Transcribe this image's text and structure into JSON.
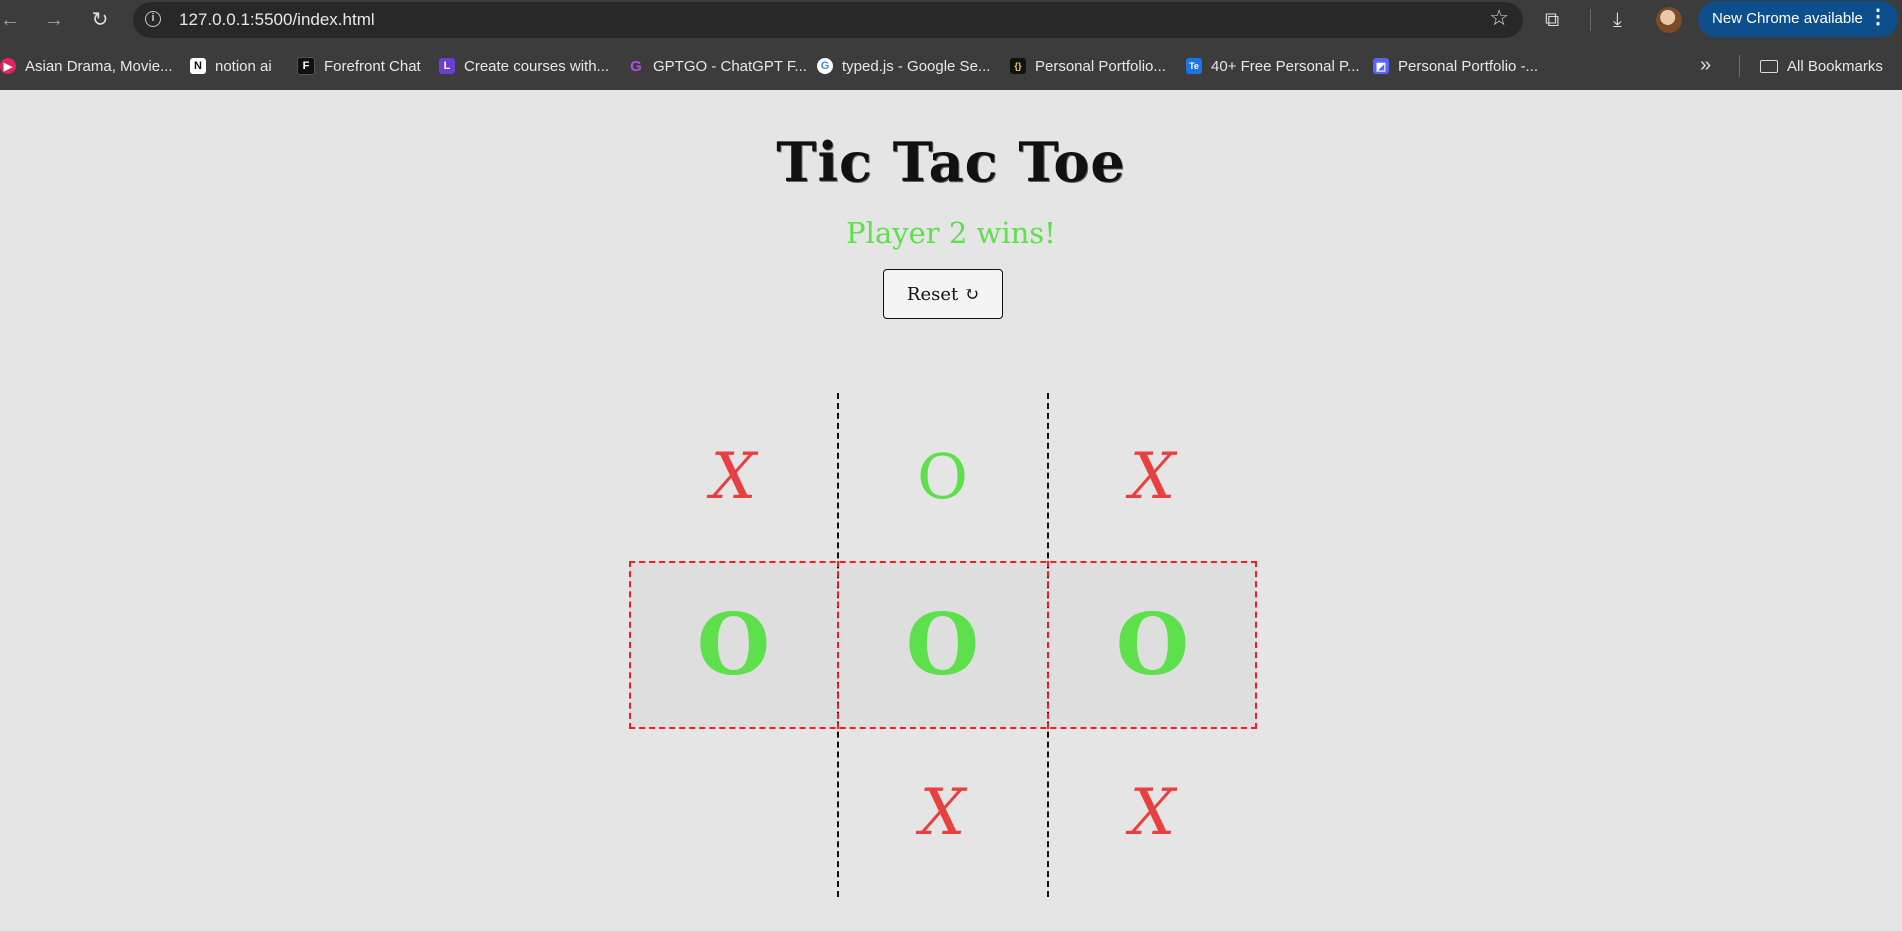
{
  "browser": {
    "url": "127.0.0.1:5500/index.html",
    "update_label": "New Chrome available",
    "bookmarks": [
      {
        "label": "Asian Drama, Movie...",
        "icon": "play-icon",
        "color": "#e0245e"
      },
      {
        "label": "notion ai",
        "icon": "notion-icon",
        "color": "#ffffff"
      },
      {
        "label": "Forefront Chat",
        "icon": "forefront-icon",
        "color": "#111111"
      },
      {
        "label": "Create courses with...",
        "icon": "letter-l-icon",
        "color": "#6b3fd6"
      },
      {
        "label": "GPTGO - ChatGPT F...",
        "icon": "letter-g-icon",
        "color": "#b14fe6"
      },
      {
        "label": "typed.js - Google Se...",
        "icon": "google-icon",
        "color": "#ffffff"
      },
      {
        "label": "Personal Portfolio...",
        "icon": "code-icon",
        "color": "#111111"
      },
      {
        "label": "40+ Free Personal P...",
        "icon": "te-icon",
        "color": "#1e73e8"
      },
      {
        "label": "Personal Portfolio -...",
        "icon": "portfolio-icon",
        "color": "#5865f2"
      }
    ],
    "all_bookmarks_label": "All Bookmarks"
  },
  "game": {
    "title": "Tic Tac Toe",
    "status": "Player 2 wins!",
    "reset_label": "Reset ↻",
    "board": [
      "X",
      "O",
      "X",
      "O",
      "O",
      "O",
      "",
      "X",
      "X"
    ],
    "winning_row": [
      3,
      4,
      5
    ],
    "x_color": "#e84040",
    "o_color": "#5de04b",
    "win_highlight_color": "#ff1a1a"
  }
}
